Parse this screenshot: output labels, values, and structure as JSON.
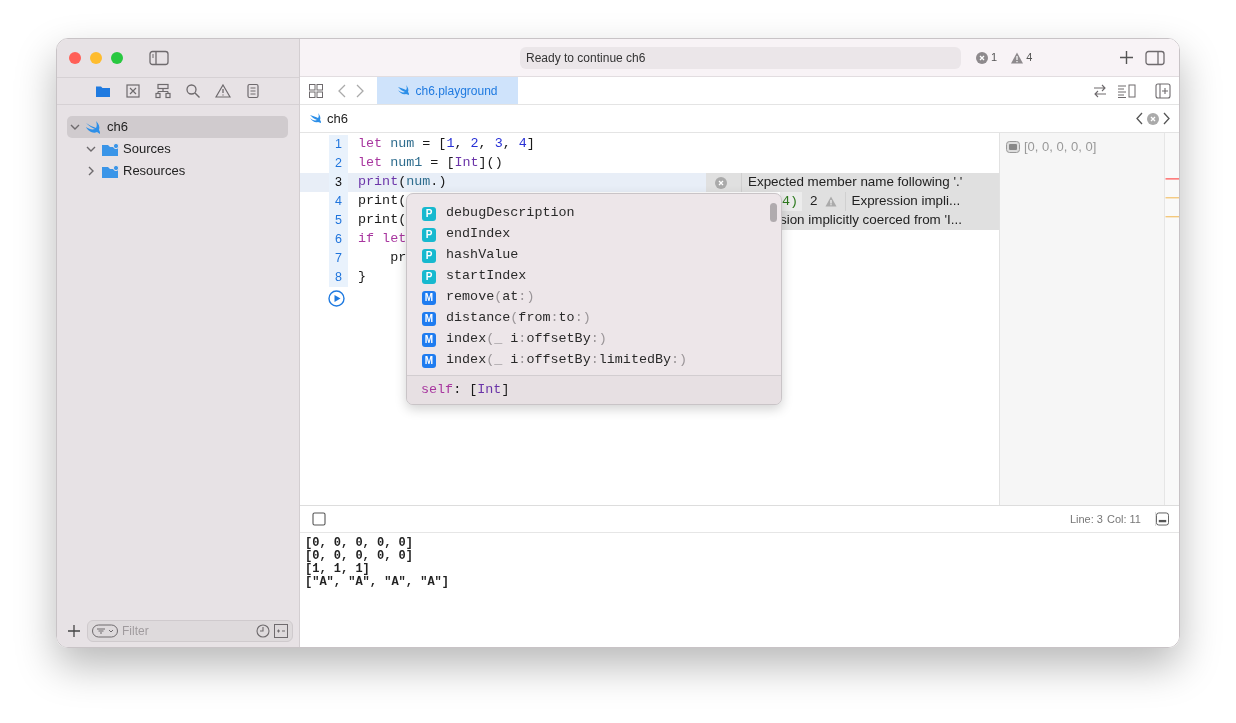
{
  "window": {
    "activity": "Ready to continue ch6",
    "error_count": "1",
    "warning_count": "4"
  },
  "navigator_tabs": [
    {
      "kind": "folder",
      "selected": true
    },
    {
      "kind": "source-control",
      "selected": false
    },
    {
      "kind": "hierarchy",
      "selected": false
    },
    {
      "kind": "search",
      "selected": false
    },
    {
      "kind": "warning",
      "selected": false
    },
    {
      "kind": "list",
      "selected": false
    }
  ],
  "tree": [
    {
      "label": "ch6",
      "kind": "playground",
      "expanded": true,
      "selected": true,
      "children": [
        {
          "label": "Sources",
          "kind": "folder",
          "expanded": true,
          "selected": false
        },
        {
          "label": "Resources",
          "kind": "folder",
          "expanded": false,
          "selected": false
        }
      ]
    }
  ],
  "filter": {
    "placeholder": "Filter"
  },
  "editor_tabs": [
    {
      "label": "ch6.playground",
      "selected": true
    }
  ],
  "breadcrumb": "ch6",
  "code_lines": [
    {
      "number": "1",
      "current": false,
      "tokens": [
        {
          "text": "let ",
          "kind": "keyword"
        },
        {
          "text": "num",
          "kind": "ident"
        },
        {
          "text": " = [",
          "kind": "plain"
        },
        {
          "text": "1",
          "kind": "number"
        },
        {
          "text": ", ",
          "kind": "plain"
        },
        {
          "text": "2",
          "kind": "number"
        },
        {
          "text": ", ",
          "kind": "plain"
        },
        {
          "text": "3",
          "kind": "number"
        },
        {
          "text": ", ",
          "kind": "plain"
        },
        {
          "text": "4",
          "kind": "number"
        },
        {
          "text": "]",
          "kind": "plain"
        }
      ],
      "result": "[0, 0, 0, 0, 0]"
    },
    {
      "number": "2",
      "current": false,
      "tokens": [
        {
          "text": "let ",
          "kind": "keyword"
        },
        {
          "text": "num1",
          "kind": "ident"
        },
        {
          "text": " = [",
          "kind": "plain"
        },
        {
          "text": "Int",
          "kind": "type"
        },
        {
          "text": "]()",
          "kind": "plain"
        }
      ]
    },
    {
      "number": "3",
      "current": true,
      "tokens": [
        {
          "text": "print",
          "kind": "function"
        },
        {
          "text": "(",
          "kind": "plain"
        },
        {
          "text": "num",
          "kind": "ident"
        },
        {
          "text": ".)",
          "kind": "plain"
        }
      ],
      "annotation": {
        "kind": "error",
        "text": "Expected member name following '.'"
      }
    },
    {
      "number": "4",
      "current": false,
      "tokens": [
        {
          "text": "print(",
          "kind": "plain"
        }
      ],
      "tail": "4)",
      "annotation": {
        "kind": "warning",
        "count": "2",
        "text": "Expression impli..."
      }
    },
    {
      "number": "5",
      "current": false,
      "tokens": [
        {
          "text": "print(",
          "kind": "plain"
        }
      ],
      "annotation": {
        "kind": "note",
        "text": "sion implicitly coerced from 'I..."
      }
    },
    {
      "number": "6",
      "current": false,
      "tokens": [
        {
          "text": "if let",
          "kind": "keyword"
        }
      ]
    },
    {
      "number": "7",
      "current": false,
      "tokens": [
        {
          "text": "    pr",
          "kind": "plain"
        }
      ]
    },
    {
      "number": "8",
      "current": false,
      "tokens": [
        {
          "text": "}",
          "kind": "plain"
        }
      ]
    }
  ],
  "completion": {
    "items": [
      {
        "kind": "property",
        "badge": "P",
        "tokens": [
          {
            "text": "debugDescription",
            "kind": "name"
          }
        ]
      },
      {
        "kind": "property",
        "badge": "P",
        "tokens": [
          {
            "text": "endIndex",
            "kind": "name"
          }
        ]
      },
      {
        "kind": "property",
        "badge": "P",
        "tokens": [
          {
            "text": "hashValue",
            "kind": "name"
          }
        ]
      },
      {
        "kind": "property",
        "badge": "P",
        "tokens": [
          {
            "text": "startIndex",
            "kind": "name"
          }
        ]
      },
      {
        "kind": "method",
        "badge": "M",
        "tokens": [
          {
            "text": "remove",
            "kind": "name"
          },
          {
            "text": "(",
            "kind": "punct"
          },
          {
            "text": "at",
            "kind": "name"
          },
          {
            "text": ":)",
            "kind": "punct"
          }
        ]
      },
      {
        "kind": "method",
        "badge": "M",
        "tokens": [
          {
            "text": "distance",
            "kind": "name"
          },
          {
            "text": "(",
            "kind": "punct"
          },
          {
            "text": "from",
            "kind": "name"
          },
          {
            "text": ":",
            "kind": "punct"
          },
          {
            "text": "to",
            "kind": "name"
          },
          {
            "text": ":)",
            "kind": "punct"
          }
        ]
      },
      {
        "kind": "method",
        "badge": "M",
        "tokens": [
          {
            "text": "index",
            "kind": "name"
          },
          {
            "text": "(_ ",
            "kind": "punct"
          },
          {
            "text": "i",
            "kind": "name"
          },
          {
            "text": ":",
            "kind": "punct"
          },
          {
            "text": "offsetBy",
            "kind": "name"
          },
          {
            "text": ":)",
            "kind": "punct"
          }
        ]
      },
      {
        "kind": "method",
        "badge": "M",
        "tokens": [
          {
            "text": "index",
            "kind": "name"
          },
          {
            "text": "(_ ",
            "kind": "punct"
          },
          {
            "text": "i",
            "kind": "name"
          },
          {
            "text": ":",
            "kind": "punct"
          },
          {
            "text": "offsetBy",
            "kind": "name"
          },
          {
            "text": ":",
            "kind": "punct"
          },
          {
            "text": "limitedBy",
            "kind": "name"
          },
          {
            "text": ":)",
            "kind": "punct"
          }
        ]
      }
    ],
    "footer": [
      {
        "text": "self",
        "kind": "keyword"
      },
      {
        "text": ": [",
        "kind": "plain"
      },
      {
        "text": "Int",
        "kind": "type"
      },
      {
        "text": "]",
        "kind": "plain"
      }
    ]
  },
  "status": {
    "line": "Line: 3",
    "column": "Col: 11"
  },
  "console": [
    "[0, 0, 0, 0, 0]",
    "[0, 0, 0, 0, 0]",
    "[1, 1, 1]",
    "[\"A\", \"A\", \"A\", \"A\"]"
  ]
}
